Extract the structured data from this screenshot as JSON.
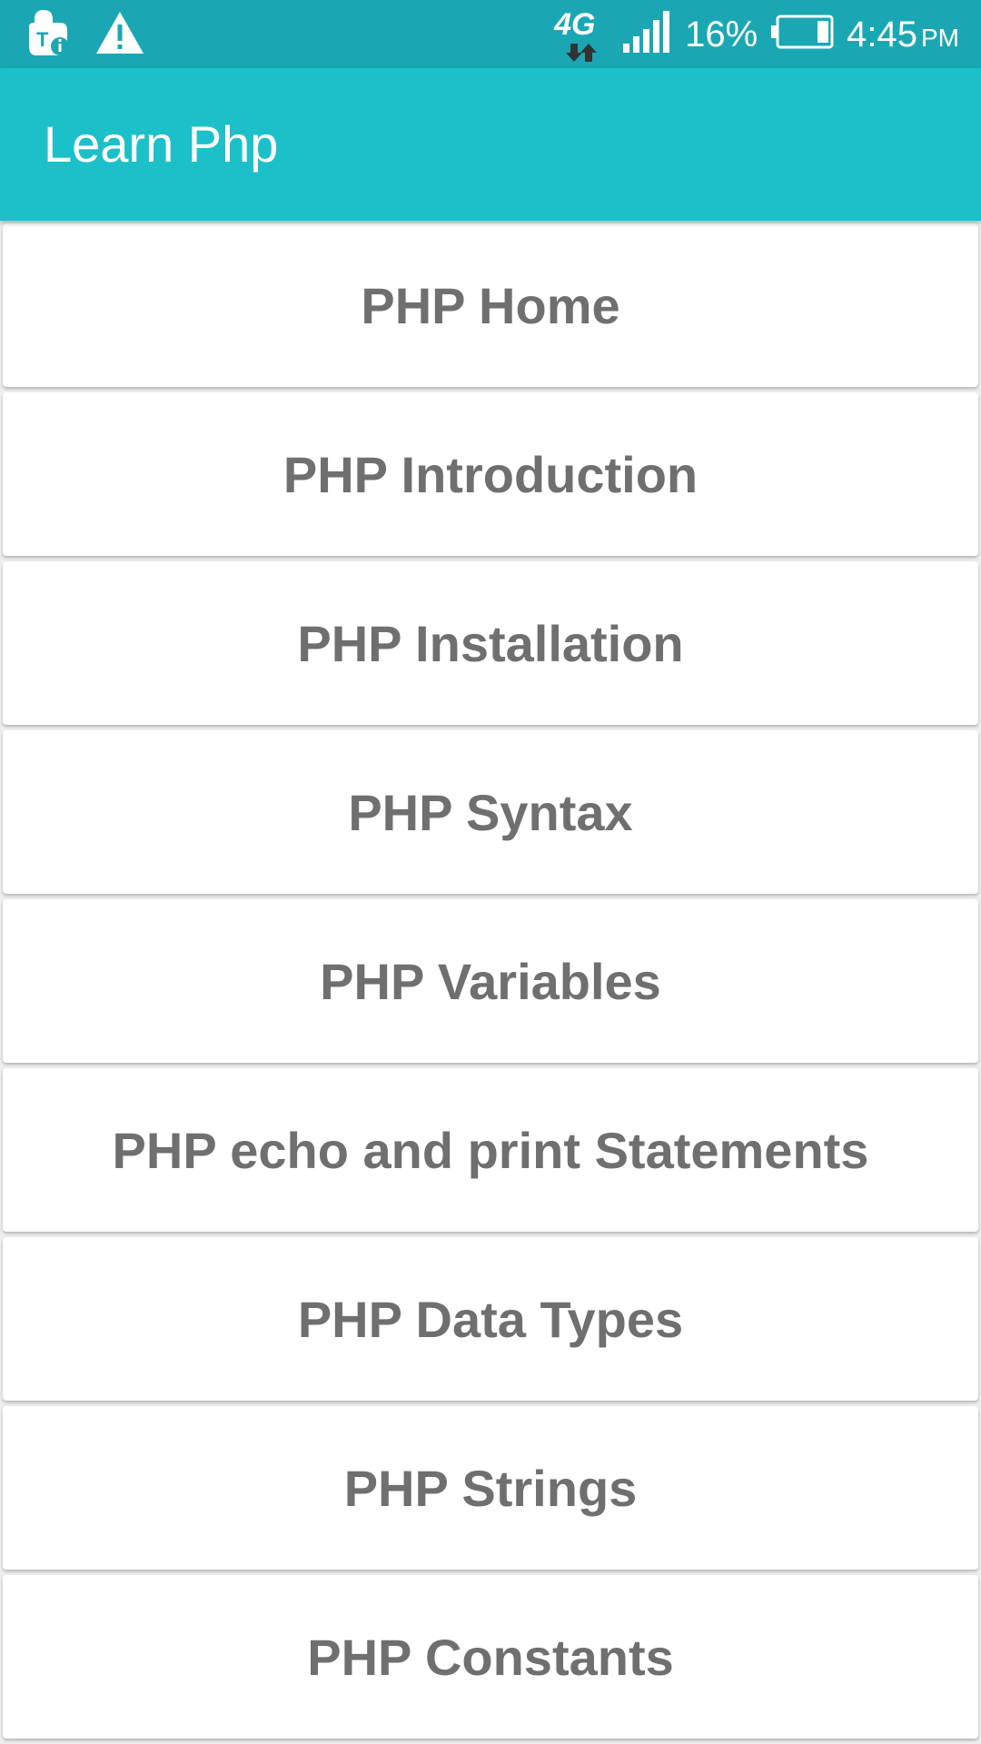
{
  "status_bar": {
    "network": "4G",
    "battery": "16%",
    "time": "4:45",
    "ampm": "PM",
    "icons": [
      "tmobile-info-icon",
      "warning-icon",
      "4g-data-icon",
      "signal-icon",
      "battery-icon"
    ]
  },
  "app_bar": {
    "title": "Learn Php",
    "color": "#1cc0c9"
  },
  "topics": {
    "items": [
      {
        "label": "PHP Home"
      },
      {
        "label": "PHP Introduction"
      },
      {
        "label": "PHP Installation"
      },
      {
        "label": "PHP Syntax"
      },
      {
        "label": "PHP Variables"
      },
      {
        "label": "PHP echo and print Statements"
      },
      {
        "label": "PHP Data Types"
      },
      {
        "label": "PHP Strings"
      },
      {
        "label": "PHP Constants"
      }
    ]
  }
}
